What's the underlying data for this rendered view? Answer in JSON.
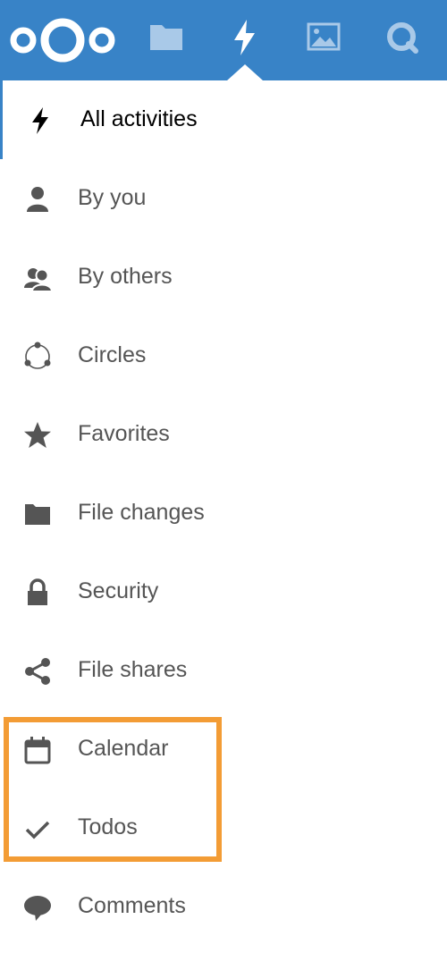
{
  "header": {
    "brand_color": "#3883c7",
    "apps": [
      {
        "name": "files",
        "icon": "folder-icon"
      },
      {
        "name": "activity",
        "icon": "lightning-icon",
        "active": true
      },
      {
        "name": "gallery",
        "icon": "image-icon"
      },
      {
        "name": "search",
        "icon": "search-icon"
      }
    ]
  },
  "nav": {
    "items": [
      {
        "label": "All activities",
        "icon": "lightning-icon",
        "active": true
      },
      {
        "label": "By you",
        "icon": "user-icon"
      },
      {
        "label": "By others",
        "icon": "users-icon"
      },
      {
        "label": "Circles",
        "icon": "circles-icon"
      },
      {
        "label": "Favorites",
        "icon": "star-icon"
      },
      {
        "label": "File changes",
        "icon": "folder-icon"
      },
      {
        "label": "Security",
        "icon": "lock-icon"
      },
      {
        "label": "File shares",
        "icon": "share-icon"
      },
      {
        "label": "Calendar",
        "icon": "calendar-icon"
      },
      {
        "label": "Todos",
        "icon": "checkmark-icon"
      },
      {
        "label": "Comments",
        "icon": "comment-icon"
      }
    ]
  },
  "highlight": {
    "color": "#f39c35",
    "items": [
      "Calendar",
      "Todos"
    ]
  }
}
